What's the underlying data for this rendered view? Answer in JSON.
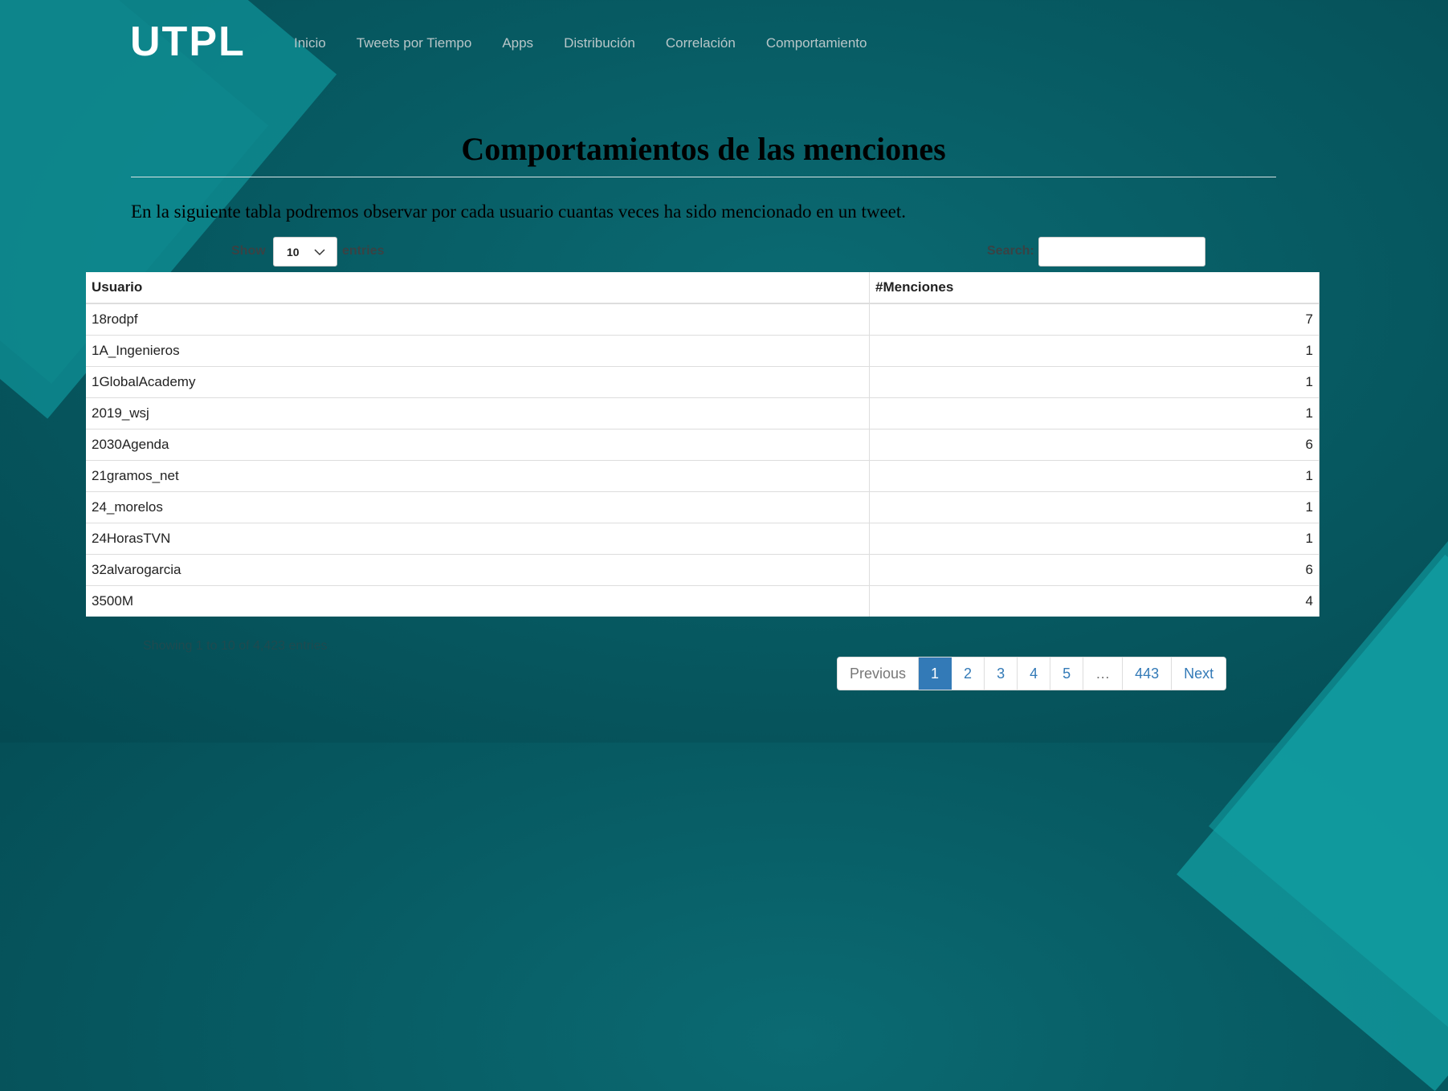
{
  "brand": {
    "logo": "UTPL"
  },
  "nav": [
    "Inicio",
    "Tweets por Tiempo",
    "Apps",
    "Distribución",
    "Correlación",
    "Comportamiento"
  ],
  "page": {
    "title": "Comportamientos de las menciones",
    "description": "En la siguiente tabla podremos observar por cada usuario cuantas veces ha sido mencionado en un tweet."
  },
  "controls": {
    "show_label": "Show",
    "page_length": "10",
    "entries_label": "entries",
    "search_label": "Search:",
    "search_value": ""
  },
  "table": {
    "headers": [
      "Usuario",
      "#Menciones"
    ],
    "rows": [
      [
        "18rodpf",
        "7"
      ],
      [
        "1A_Ingenieros",
        "1"
      ],
      [
        "1GlobalAcademy",
        "1"
      ],
      [
        "2019_wsj",
        "1"
      ],
      [
        "2030Agenda",
        "6"
      ],
      [
        "21gramos_net",
        "1"
      ],
      [
        "24_morelos",
        "1"
      ],
      [
        "24HorasTVN",
        "1"
      ],
      [
        "32alvarogarcia",
        "6"
      ],
      [
        "3500M",
        "4"
      ]
    ]
  },
  "info": "Showing 1 to 10 of 4,423 entries",
  "pagination": {
    "previous": "Previous",
    "pages": [
      "1",
      "2",
      "3",
      "4",
      "5",
      "…",
      "443"
    ],
    "current": "1",
    "next": "Next"
  },
  "colors": {
    "accent": "#337ab7",
    "background": "#075b63"
  }
}
